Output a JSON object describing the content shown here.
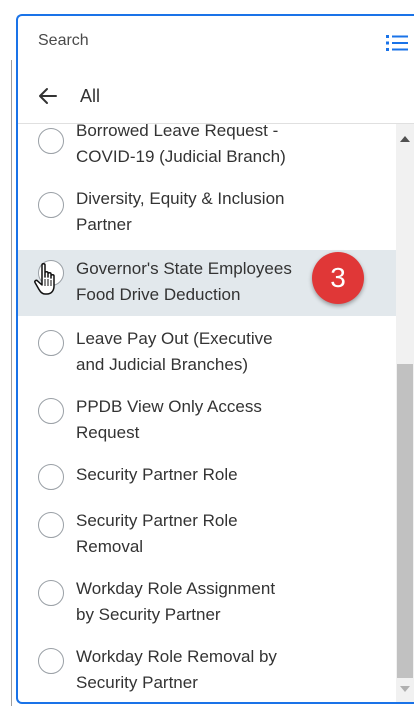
{
  "search": {
    "placeholder": "Search"
  },
  "icons": {
    "list_view": "list-view-icon",
    "back": "arrow-left-icon",
    "cursor": "hand-pointer-icon"
  },
  "colors": {
    "accent": "#1a73e8",
    "selected_row": "#e2e8ec",
    "badge": "#e03737"
  },
  "back": {
    "label": "All"
  },
  "items": [
    {
      "lines": [
        "Borrowed Leave Request -",
        "COVID-19 (Judicial Branch)"
      ],
      "selected": false
    },
    {
      "lines": [
        "Diversity, Equity & Inclusion",
        "Partner"
      ],
      "selected": false
    },
    {
      "lines": [
        "Governor's State Employees",
        "Food Drive Deduction"
      ],
      "selected": true
    },
    {
      "lines": [
        "Leave Pay Out (Executive",
        "and Judicial Branches)"
      ],
      "selected": false
    },
    {
      "lines": [
        "PPDB View Only Access",
        "Request"
      ],
      "selected": false
    },
    {
      "lines": [
        "Security Partner Role",
        ""
      ],
      "selected": false
    },
    {
      "lines": [
        "Security Partner Role",
        "Removal"
      ],
      "selected": false
    },
    {
      "lines": [
        "Workday Role Assignment",
        "by Security Partner"
      ],
      "selected": false
    },
    {
      "lines": [
        "Workday Role Removal by",
        "Security Partner"
      ],
      "selected": false
    }
  ],
  "step_badge": {
    "label": "3"
  }
}
